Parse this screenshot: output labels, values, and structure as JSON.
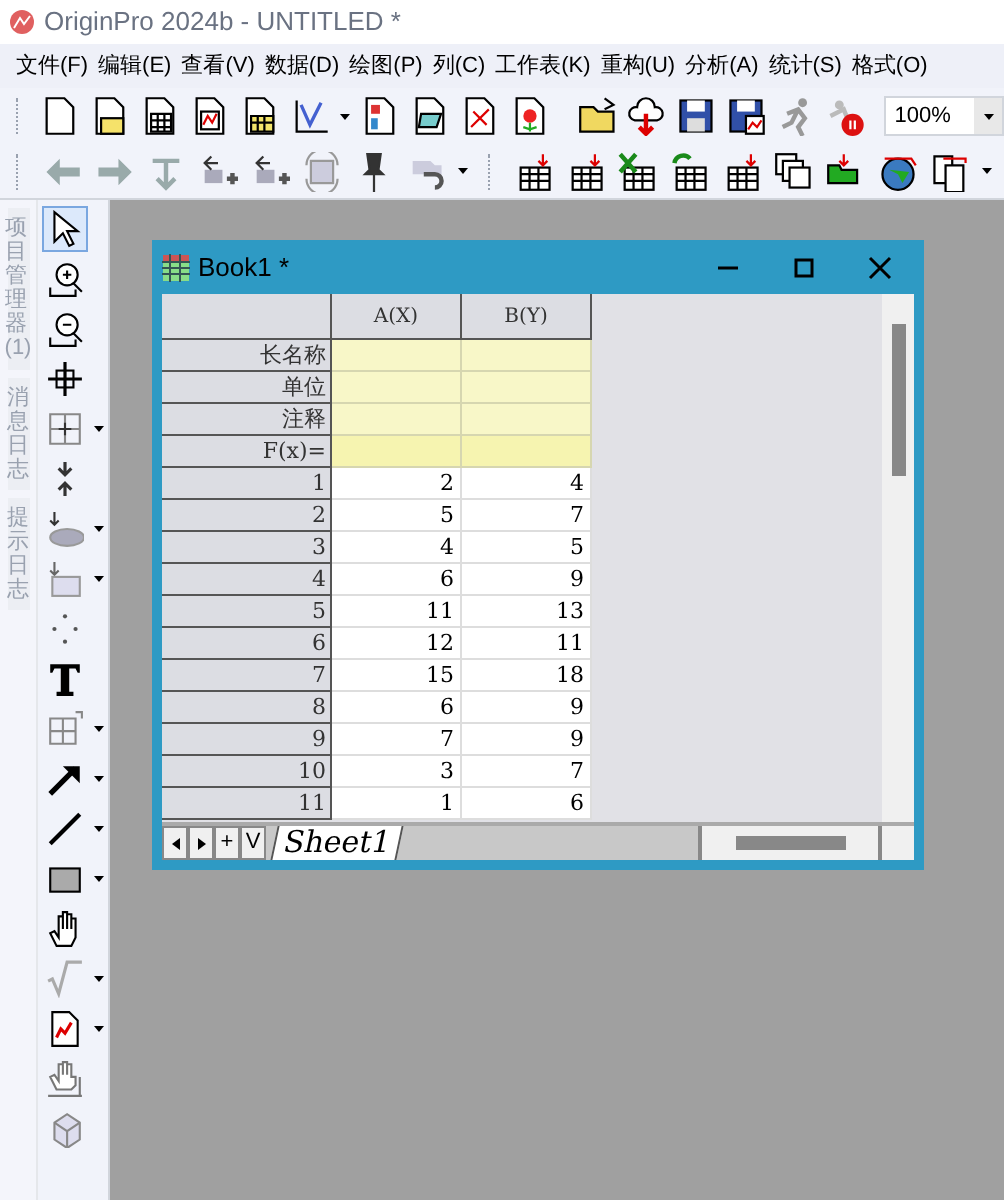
{
  "window": {
    "title": "OriginPro 2024b - UNTITLED *"
  },
  "menu": [
    "文件(F)",
    "编辑(E)",
    "查看(V)",
    "数据(D)",
    "绘图(P)",
    "列(C)",
    "工作表(K)",
    "重构(U)",
    "分析(A)",
    "统计(S)",
    "格式(O)"
  ],
  "zoom_field": {
    "value": "100%"
  },
  "side_panels": [
    {
      "label": "项目管理器 (1)"
    },
    {
      "label": "消息日志"
    },
    {
      "label": "提示日志"
    }
  ],
  "tools": [
    {
      "selected": true
    },
    {
      "selected": false
    },
    {
      "selected": false
    },
    {
      "selected": false
    },
    {
      "selected": false
    },
    {
      "selected": false
    },
    {
      "selected": false
    },
    {
      "selected": false
    },
    {
      "selected": false
    },
    {
      "selected": false
    },
    {
      "selected": false
    },
    {
      "selected": false
    },
    {
      "selected": false
    },
    {
      "selected": false
    },
    {
      "selected": false
    },
    {
      "selected": false
    },
    {
      "selected": false
    },
    {
      "selected": false
    },
    {
      "selected": false
    }
  ],
  "workbook": {
    "title": "Book1 *",
    "columns": [
      "A(X)",
      "B(Y)"
    ],
    "label_rows": [
      "长名称",
      "单位",
      "注释",
      "F(x)="
    ],
    "rows": [
      {
        "label": "1",
        "cells": [
          "2",
          "4"
        ]
      },
      {
        "label": "2",
        "cells": [
          "5",
          "7"
        ]
      },
      {
        "label": "3",
        "cells": [
          "4",
          "5"
        ]
      },
      {
        "label": "4",
        "cells": [
          "6",
          "9"
        ]
      },
      {
        "label": "5",
        "cells": [
          "11",
          "13"
        ]
      },
      {
        "label": "6",
        "cells": [
          "12",
          "11"
        ]
      },
      {
        "label": "7",
        "cells": [
          "15",
          "18"
        ]
      },
      {
        "label": "8",
        "cells": [
          "6",
          "9"
        ]
      },
      {
        "label": "9",
        "cells": [
          "7",
          "9"
        ]
      },
      {
        "label": "10",
        "cells": [
          "3",
          "7"
        ]
      },
      {
        "label": "11",
        "cells": [
          "1",
          "6"
        ]
      }
    ],
    "sheet_nav": [
      "+",
      "V"
    ],
    "sheet_tabs": [
      {
        "label": "Sheet1",
        "selected": true
      }
    ]
  }
}
